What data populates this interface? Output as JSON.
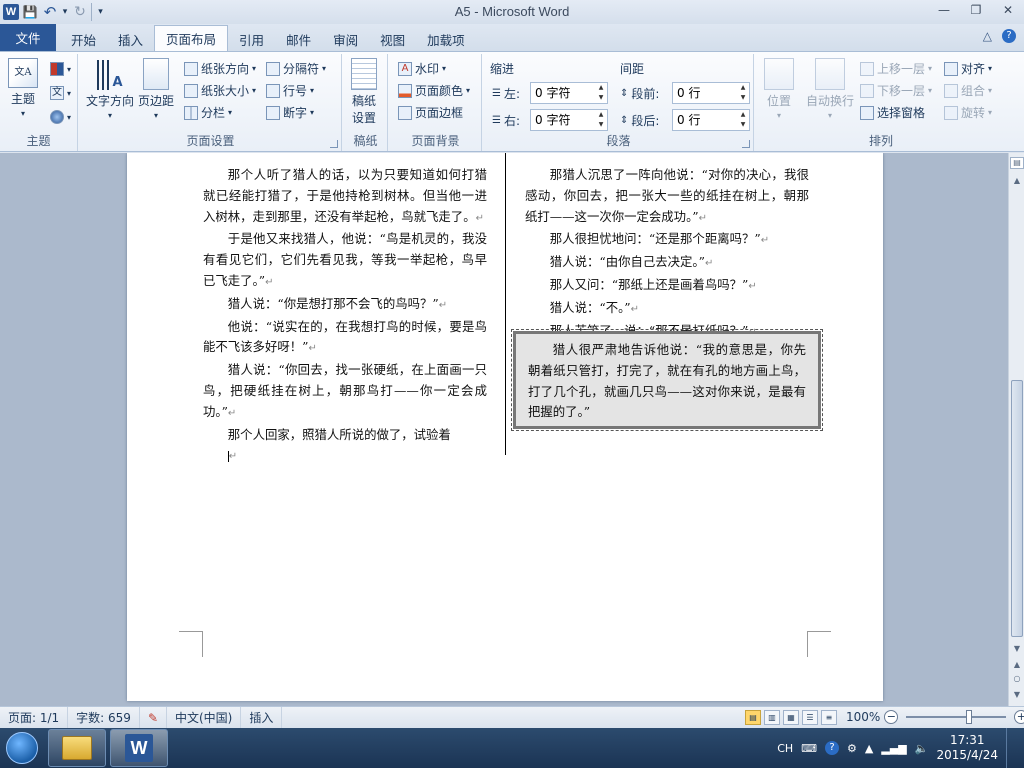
{
  "window": {
    "title": "A5 - Microsoft Word",
    "min": "—",
    "max": "❐",
    "close": "✕"
  },
  "qat": {
    "logo": "W",
    "save": "💾",
    "undo": "↶",
    "undo_drop": "▾",
    "redo": "↻",
    "customize": "▾"
  },
  "tabs": [
    "文件",
    "开始",
    "插入",
    "页面布局",
    "引用",
    "邮件",
    "审阅",
    "视图",
    "加载项"
  ],
  "help": {
    "min_ribbon": "△",
    "help": "?"
  },
  "ribbon": {
    "theme": {
      "label": "主题",
      "btn": "主题"
    },
    "page_setup": {
      "label": "页面设置",
      "text_direction": "文字方向",
      "margins": "页边距",
      "orientation": "纸张方向",
      "size": "纸张大小",
      "columns": "分栏",
      "breaks": "分隔符",
      "line_numbers": "行号",
      "hyphenation": "断字"
    },
    "draft": {
      "label": "稿纸",
      "btn1": "稿纸",
      "btn2": "设置"
    },
    "background": {
      "label": "页面背景",
      "watermark": "水印",
      "page_color": "页面颜色",
      "page_borders": "页面边框"
    },
    "paragraph": {
      "label": "段落",
      "indent": "缩进",
      "spacing": "间距",
      "left": "左:",
      "right": "右:",
      "before": "段前:",
      "after": "段后:",
      "left_val": "0 字符",
      "right_val": "0 字符",
      "before_val": "0 行",
      "after_val": "0 行"
    },
    "arrange": {
      "label": "排列",
      "position": "位置",
      "wrap": "自动换行",
      "forward": "上移一层",
      "backward": "下移一层",
      "pane": "选择窗格",
      "align": "对齐",
      "group": "组合",
      "rotate": "旋转"
    }
  },
  "document": {
    "left_column": [
      "那个人听了猎人的话，以为只要知道如何打猎就已经能打猎了，于是他持枪到树林。但当他一进入树林，走到那里，还没有举起枪，鸟就飞走了。",
      "于是他又来找猎人，他说：“鸟是机灵的，我没有看见它们，它们先看见我，等我一举起枪，鸟早已飞走了。”",
      "猎人说：“你是想打那不会飞的鸟吗？”",
      "他说：“说实在的，在我想打鸟的时候，要是鸟能不飞该多好呀！”",
      "猎人说：“你回去，找一张硬纸，在上面画一只鸟，把硬纸挂在树上，朝那鸟打——你一定会成功。”",
      "那个人回家，照猎人所说的做了，试验着"
    ],
    "right_column": [
      "那猎人沉思了一阵向他说：“对你的决心，我很感动，你回去，把一张大一些的纸挂在树上，朝那纸打——这一次你一定会成功。”",
      "那人很担忧地问：“还是那个距离吗？”",
      "猎人说：“由你自己去决定。”",
      "那人又问：“那纸上还是画着鸟吗？”",
      "猎人说：“不。”",
      "那人苦笑了，说：“那不是打纸吗？”"
    ],
    "boxed": "猎人很严肃地告诉他说：“我的意思是，你先朝着纸只管打，打完了，就在有孔的地方画上鸟，打了几个孔，就画几只鸟——这对你来说，是最有把握的了。”",
    "para_mark": "↵",
    "cursor_mark": "↵"
  },
  "status": {
    "page": "页面: 1/1",
    "words": "字数: 659",
    "language": "中文(中国)",
    "mode": "插入",
    "zoom": "100%",
    "zoom_minus": "−",
    "zoom_plus": "+"
  },
  "taskbar": {
    "ime": "CH",
    "time": "17:31",
    "date": "2015/4/24"
  }
}
